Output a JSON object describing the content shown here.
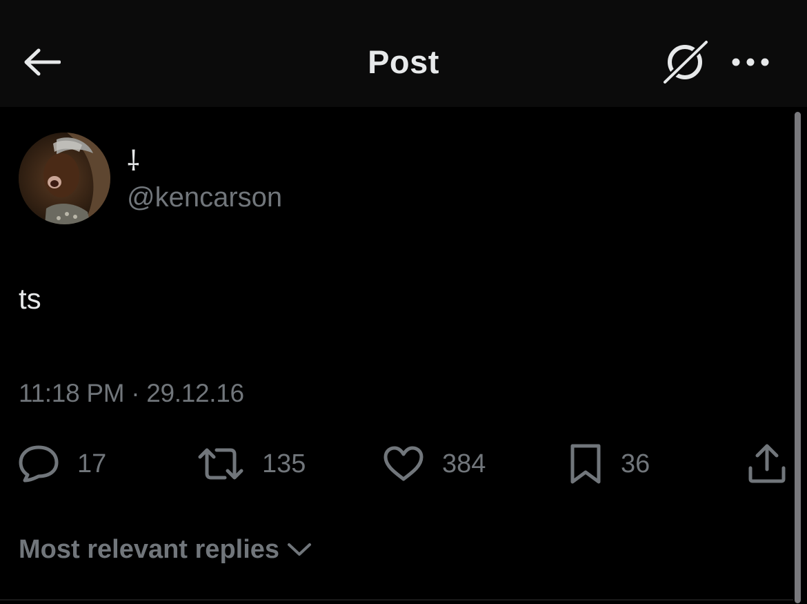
{
  "header": {
    "title": "Post"
  },
  "author": {
    "display_name": "⸸",
    "handle": "@kencarson"
  },
  "post": {
    "text": "ts",
    "timestamp": "11:18 PM · 29.12.16"
  },
  "actions": {
    "replies": "17",
    "reposts": "135",
    "likes": "384",
    "bookmarks": "36"
  },
  "replies_sort": {
    "label": "Most relevant replies"
  },
  "icons": {
    "back": "arrow-left-icon",
    "grok": "grok-icon",
    "more": "more-dots-icon",
    "reply": "speech-bubble-icon",
    "repost": "repost-icon",
    "like": "heart-icon",
    "bookmark": "bookmark-icon",
    "share": "share-icon",
    "sort": "chevron-down-icon"
  },
  "colors": {
    "background": "#000000",
    "header_background": "#0b0b0b",
    "primary_text": "#e7e9ea",
    "secondary_text": "#71767b"
  }
}
